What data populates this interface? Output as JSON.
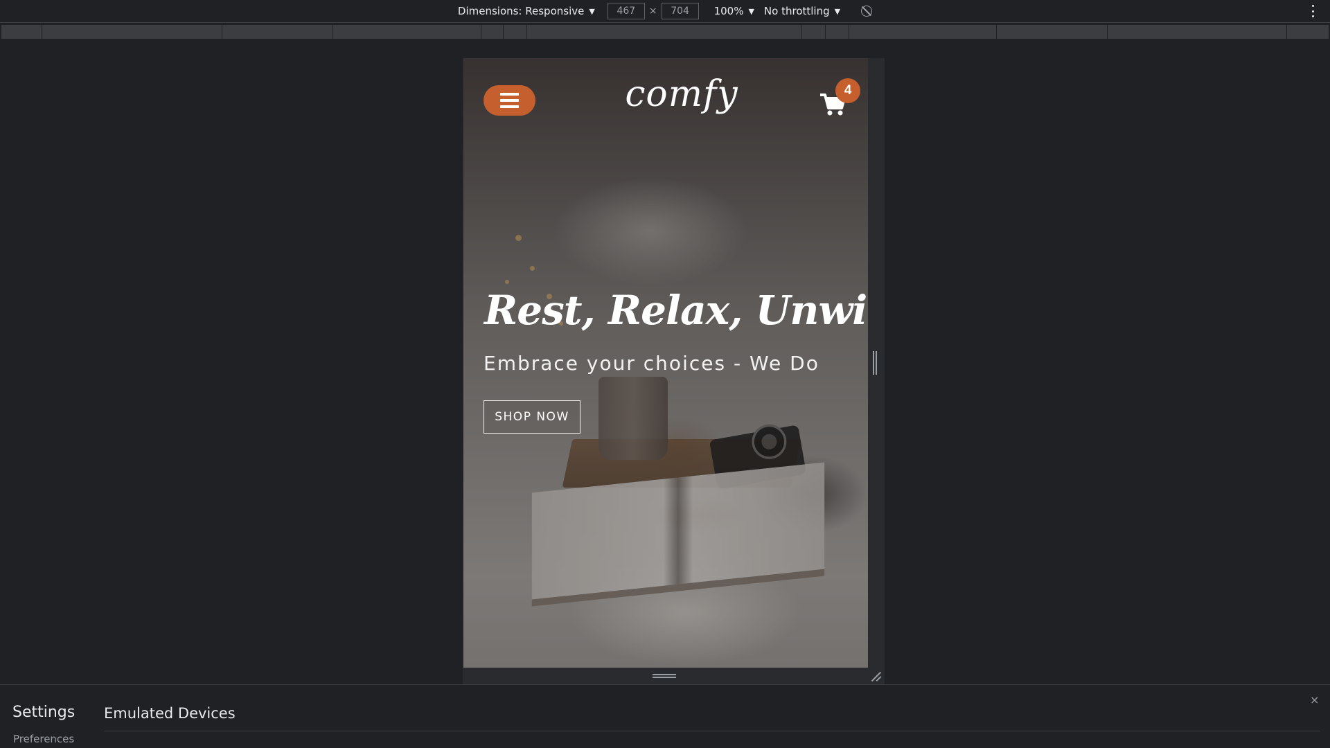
{
  "devtools_toolbar": {
    "dimensions_label": "Dimensions: Responsive",
    "width_value": "467",
    "times_symbol": "×",
    "height_value": "704",
    "zoom_label": "100%",
    "throttling_label": "No throttling",
    "caret": "▼"
  },
  "site": {
    "logo": "comfy",
    "cart_count": "4",
    "hero_title": "Rest, Relax, Unwind",
    "hero_subtitle": "Embrace your choices - We Do",
    "cta_label": "SHOP NOW",
    "accent_color": "#c5602e"
  },
  "settings_drawer": {
    "title": "Settings",
    "nav_item": "Preferences",
    "section_title": "Emulated Devices",
    "close_symbol": "×"
  }
}
